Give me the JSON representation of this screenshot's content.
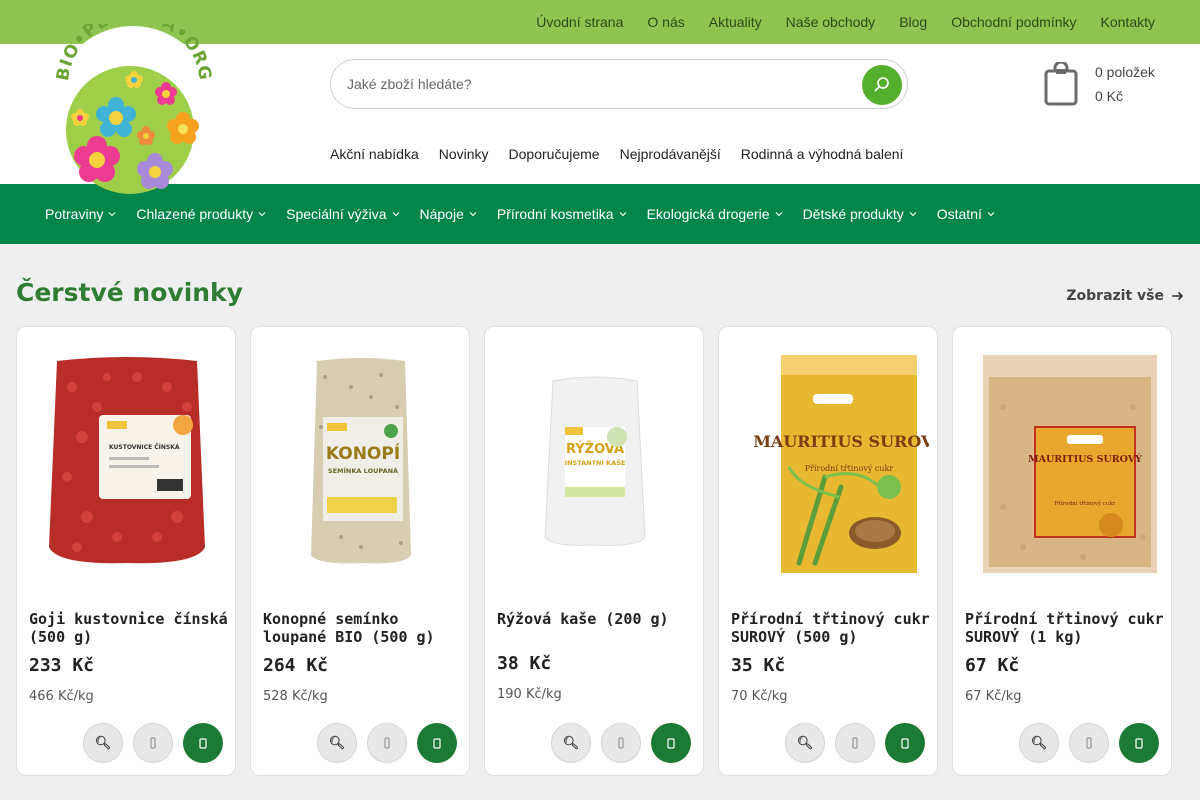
{
  "topnav": {
    "items": [
      "Úvodní strana",
      "O nás",
      "Aktuality",
      "Naše obchody",
      "Blog",
      "Obchodní podmínky",
      "Kontakty"
    ]
  },
  "logo": {
    "text": "BIO PLANETA.ORG"
  },
  "search": {
    "placeholder": "Jaké zboží hledáte?"
  },
  "cart": {
    "items": "0 položek",
    "total": "0 Kč"
  },
  "subnav": {
    "items": [
      "Akční nabídka",
      "Novinky",
      "Doporučujeme",
      "Nejprodávanější",
      "Rodinná a výhodná balení"
    ]
  },
  "mainnav": {
    "items": [
      "Potraviny",
      "Chlazené produkty",
      "Speciální výživa",
      "Nápoje",
      "Přírodní kosmetika",
      "Ekologická drogerie",
      "Dětské produkty",
      "Ostatní"
    ]
  },
  "section": {
    "title": "Čerstvé novinky",
    "show_all": "Zobrazit vše"
  },
  "products": [
    {
      "name": "Goji kustovnice čínská (500 g)",
      "price": "233 Kč",
      "unit": "466 Kč/kg",
      "bag_label": "KUSTOVNICE ČÍNSKÁ",
      "bag_color": "#c8342d"
    },
    {
      "name": "Konopné semínko loupané BIO (500 g)",
      "price": "264 Kč",
      "unit": "528 Kč/kg",
      "bag_label": "KONOPÍ",
      "bag_sub": "SEMÍNKA LOUPANÁ",
      "bag_color": "#d9ceb0"
    },
    {
      "name": "Rýžová kaše (200 g)",
      "price": "38 Kč",
      "unit": "190 Kč/kg",
      "bag_label": "RÝŽOVÁ",
      "bag_sub": "INSTANTNÍ KAŠE",
      "bag_color": "#f4f4f4"
    },
    {
      "name": "Přírodní třtinový cukr SUROVÝ (500 g)",
      "price": "35 Kč",
      "unit": "70 Kč/kg",
      "bag_label": "MAURITIUS SUROVÝ",
      "bag_sub": "Přírodní třtinový cukr",
      "bag_color": "#e8b830"
    },
    {
      "name": "Přírodní třtinový cukr SUROVÝ (1 kg)",
      "price": "67 Kč",
      "unit": "67 Kč/kg",
      "bag_label": "MAURITIUS SUROVÝ",
      "bag_sub": "Přírodní třtinový cukr",
      "bag_color": "#d9b48a"
    }
  ],
  "colors": {
    "topbar": "#8ec44f",
    "mainnav": "#04854a",
    "accent_green": "#54b02c",
    "title_green": "#2e7d32",
    "cart_green": "#1c7a34"
  }
}
